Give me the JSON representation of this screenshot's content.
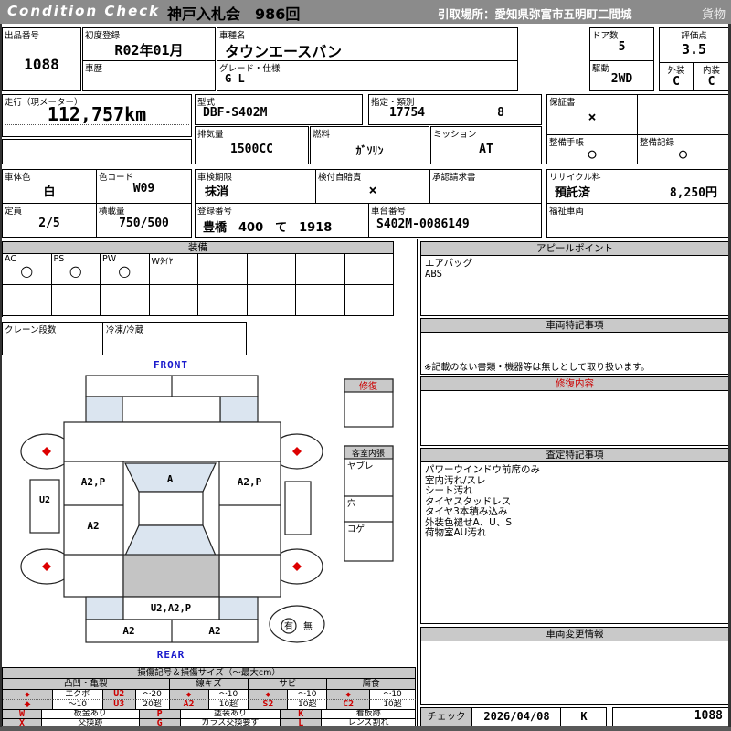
{
  "header": {
    "brand": "Condition Check",
    "auction_title": "神戸入札会　986回",
    "pickup_location": "引取場所：愛知県弥富市五明町二間城",
    "category": "貨物"
  },
  "info": {
    "lot_label": "出品番号",
    "lot_no": "1088",
    "first_reg_label": "初度登録",
    "first_reg": "R02年01月",
    "history_label": "車歴",
    "history": "",
    "model_name_label": "車種名",
    "model_name": "タウンエースバン",
    "grade_label": "グレード・仕様",
    "grade": "G L",
    "doors_label": "ドア数",
    "doors": "5",
    "drive_label": "駆動",
    "drive": "2WD",
    "score_label": "評価点",
    "score": "3.5",
    "exterior_label": "外装",
    "exterior": "C",
    "interior_label": "内装",
    "interior": "C",
    "mileage_label": "走行（現メーター）",
    "mileage": "112,757km",
    "model_code_label": "型式",
    "model_code": "DBF-S402M",
    "class_label": "指定・類別",
    "class_no": "17754",
    "class_sub": "8",
    "displacement_label": "排気量",
    "displacement": "1500CC",
    "fuel_label": "燃料",
    "fuel": "ｶﾞｿﾘﾝ",
    "transmission_label": "ミッション",
    "transmission": "AT",
    "warranty_label": "保証書",
    "warranty": "×",
    "maintenance_book_label": "整備手帳",
    "maintenance_book": "○",
    "maintenance_record_label": "整備記録",
    "maintenance_record": "○",
    "body_color_label": "車体色",
    "body_color": "白",
    "color_code_label": "色コード",
    "color_code": "W09",
    "inspection_label": "車検期限",
    "inspection": "抹消",
    "insurance_label": "検付自賠責",
    "insurance": "×",
    "approval_label": "承認請求書",
    "approval": "",
    "recycle_label": "リサイクル料",
    "recycle_status": "預託済",
    "recycle_fee": "8,250円",
    "capacity_label": "定員",
    "capacity": "2/5",
    "load_label": "積載量",
    "load": "750/500",
    "reg_no_label": "登録番号",
    "reg_no": "豊橋　400　て　1918",
    "chassis_label": "車台番号",
    "chassis_no": "S402M-0086149",
    "welfare_label": "福祉車両",
    "welfare": ""
  },
  "equipment": {
    "title": "装備",
    "cells": [
      {
        "label": "AC",
        "mark": "○"
      },
      {
        "label": "PS",
        "mark": "○"
      },
      {
        "label": "PW",
        "mark": "○"
      },
      {
        "label": "Wﾀｲﾔ",
        "mark": ""
      },
      {
        "label": "",
        "mark": ""
      },
      {
        "label": "",
        "mark": ""
      },
      {
        "label": "",
        "mark": ""
      },
      {
        "label": "",
        "mark": ""
      }
    ],
    "crane_label": "クレーン段数",
    "crane": "",
    "freezer_label": "冷凍/冷蔵",
    "freezer": ""
  },
  "appeal": {
    "title": "アピールポイント",
    "line1": "エアバッグ",
    "line2": "ABS"
  },
  "vehicle_notes": {
    "title": "車両特記事項",
    "note": "※記載のない書類・機器等は無しとして取り扱います。"
  },
  "repair": {
    "title": "修復内容",
    "content": ""
  },
  "assessment": {
    "title": "査定特記事項",
    "line1": "パワーウインドウ前席のみ",
    "line2": "室内汚れ/スレ",
    "line3": "シート汚れ",
    "line4": "タイヤスタッドレス",
    "line5": "タイヤ3本積み込み",
    "line6": "外装色褪せA、U、S",
    "line7": "荷物室AU汚れ"
  },
  "change_info": {
    "title": "車両変更情報",
    "content": ""
  },
  "check": {
    "label": "チェック",
    "date": "2026/04/08",
    "inspector": "K",
    "lot_no": "1088"
  },
  "diagram": {
    "front_label": "FRONT",
    "rear_label": "REAR",
    "windshield": "A",
    "front_left_door": "A2,P",
    "front_right_door": "A2,P",
    "left_slide": "U2",
    "left_rear_panel": "A2",
    "rear_gate": "U2,A2,P",
    "rear_bumper_left": "A2",
    "rear_bumper_right": "A2",
    "repair_box_title": "修復",
    "interior_box_title": "客室内張",
    "interior_row1": "ヤブレ",
    "interior_row2": "穴",
    "interior_row3": "コゲ",
    "presence_yes": "有",
    "presence_no": "無"
  },
  "legend": {
    "title": "損傷記号＆損傷サイズ（～最大cm）",
    "groups": [
      "凸凹・亀裂",
      "線キズ",
      "サビ",
      "腐食"
    ],
    "row1": [
      "◆",
      "エクボ",
      "U2",
      "～20",
      "◆",
      "～10",
      "◆",
      "～10",
      "◆",
      "～10"
    ],
    "row2": [
      "◆",
      "～10",
      "U3",
      "20超",
      "A2",
      "10超",
      "S2",
      "10超",
      "C2",
      "10超"
    ],
    "code_w": "W",
    "code_w_desc": "板金あり",
    "code_p": "P",
    "code_p_desc": "塗装あり",
    "code_k": "K",
    "code_k_desc": "看板跡",
    "code_x": "X",
    "code_x_desc": "交換跡",
    "code_g": "G",
    "code_g_desc": "ガラス交換要す",
    "code_l": "L",
    "code_l_desc": "レンズ割れ"
  },
  "colors": {
    "header_bg": "#8b8b8b",
    "section_header_bg": "#c9c9c9",
    "accent_red": "#cc0000",
    "glass_blue": "#dbe5f0",
    "roof_gray": "#c4c4c4",
    "front_rear_blue": "#1a1acc"
  }
}
